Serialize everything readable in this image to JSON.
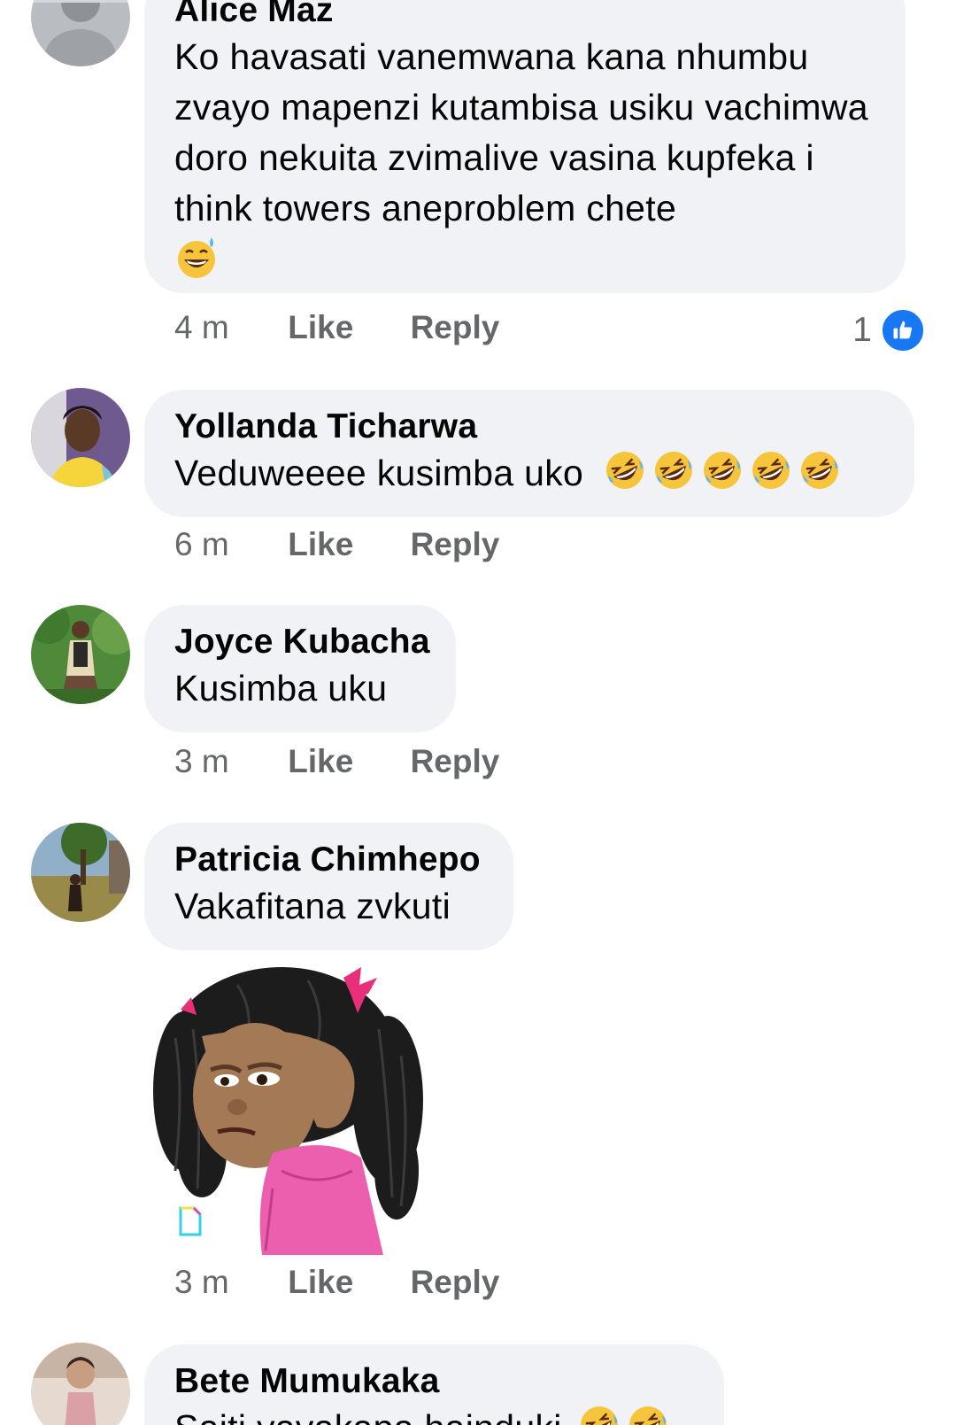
{
  "comments": [
    {
      "author": "Alice Maz",
      "text": "Ko havasati vanemwana kana nhumbu zvayo mapenzi kutambisa usiku vachimwa doro nekuita zvimalive vasina kupfeka i think towers aneproblem chete",
      "emoji": "grinning-sweat-emoji",
      "time": "4 m",
      "like_label": "Like",
      "reply_label": "Reply",
      "reaction_count": "1"
    },
    {
      "author": "Yollanda Ticharwa",
      "text": "Veduweeee kusimba uko",
      "emoji": "rolling-laughing-emoji",
      "emoji_count": 5,
      "time": "6 m",
      "like_label": "Like",
      "reply_label": "Reply"
    },
    {
      "author": "Joyce Kubacha",
      "text": "Kusimba uku",
      "time": "3 m",
      "like_label": "Like",
      "reply_label": "Reply"
    },
    {
      "author": "Patricia Chimhepo",
      "text": "Vakafitana zvkuti",
      "sticker": "puppet-girl-salute-sticker",
      "time": "3 m",
      "like_label": "Like",
      "reply_label": "Reply"
    },
    {
      "author": "Bete Mumukaka",
      "text": "Saiti yavakapa hainduki",
      "emoji": "rolling-laughing-emoji",
      "emoji_count": 2
    }
  ],
  "colors": {
    "bubble": "#f0f2f5",
    "meta_text": "#65676b",
    "like_blue": "#1877f2"
  }
}
